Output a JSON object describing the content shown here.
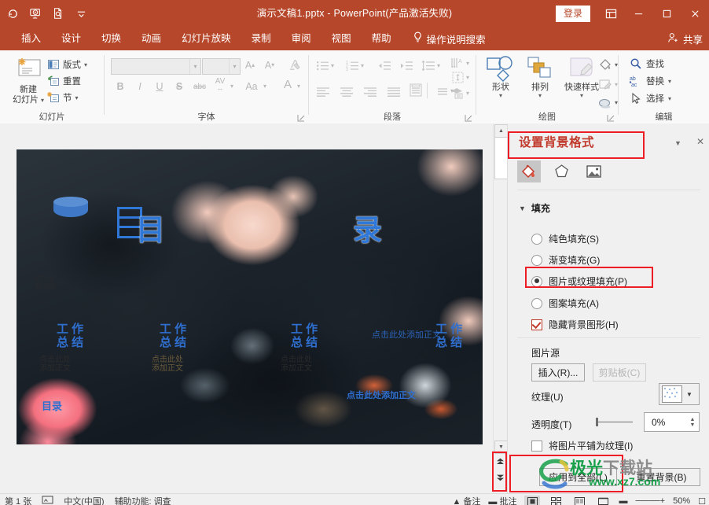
{
  "titlebar": {
    "document_title": "演示文稿1.pptx  -  PowerPoint(产品激活失败)",
    "signin_label": "登录",
    "quick_access": [
      {
        "name": "autosave-icon",
        "label": ""
      },
      {
        "name": "start-from-beginning-icon",
        "label": ""
      },
      {
        "name": "print-preview-icon",
        "label": ""
      },
      {
        "name": "customize-quick-access-toolbar-icon",
        "label": ""
      }
    ],
    "window_buttons": [
      "ribbon-display-options",
      "minimize",
      "maximize",
      "close"
    ]
  },
  "ribbon_tabs": {
    "items": [
      {
        "label": "插入"
      },
      {
        "label": "设计"
      },
      {
        "label": "切换"
      },
      {
        "label": "动画"
      },
      {
        "label": "幻灯片放映"
      },
      {
        "label": "录制"
      },
      {
        "label": "审阅"
      },
      {
        "label": "视图"
      },
      {
        "label": "帮助"
      }
    ],
    "tell_me": "操作说明搜索",
    "share": "共享"
  },
  "ribbon": {
    "groups": [
      {
        "name": "slide",
        "label": "幻灯片"
      },
      {
        "name": "font",
        "label": "字体"
      },
      {
        "name": "paragraph",
        "label": "段落"
      },
      {
        "name": "drawing",
        "label": "绘图"
      },
      {
        "name": "editing",
        "label": "编辑"
      }
    ],
    "slide_group": {
      "new_slide_line1": "新建",
      "new_slide_line2": "幻灯片",
      "layout": "版式",
      "reset": "重置",
      "section": "节"
    },
    "font_group": {
      "font_name_value": "",
      "font_size_value": "",
      "buttons": [
        "B",
        "I",
        "U",
        "S",
        "abc",
        "AV",
        "Aa",
        "A"
      ]
    },
    "drawing_group": {
      "shapes": "形状",
      "arrange": "排列",
      "quick_styles": "快速样式"
    },
    "editing_group": {
      "find": "查找",
      "replace": "替换",
      "select": "选择"
    }
  },
  "slide": {
    "texts": [
      {
        "id": "title-mu",
        "text": "目"
      },
      {
        "id": "title-lu",
        "text": "录"
      },
      {
        "id": "heading-1",
        "text": "工 作\n总 结"
      },
      {
        "id": "heading-2",
        "text": "工 作\n总 结"
      },
      {
        "id": "heading-3",
        "text": "工 作\n总 结"
      },
      {
        "id": "heading-4",
        "text": "工 作\n总 结"
      },
      {
        "id": "body-1",
        "text": "点击此处\n添加正文"
      },
      {
        "id": "body-2",
        "text": "点击此处\n添加正文"
      },
      {
        "id": "body-3",
        "text": "点击此处\n添加正文"
      },
      {
        "id": "body-4",
        "text": "点击此处添加正文"
      },
      {
        "id": "body-5",
        "text": "点击此处添加正文"
      },
      {
        "id": "small-left",
        "text": "点击此\n处添加"
      },
      {
        "id": "catalog",
        "text": "目录"
      }
    ]
  },
  "pane": {
    "title": "设置背景格式",
    "collapse_icon": "chevron-down-icon",
    "close_icon": "close-icon",
    "tabs": [
      {
        "name": "fill-tab",
        "selected": true
      },
      {
        "name": "effects-tab",
        "selected": false
      },
      {
        "name": "picture-tab",
        "selected": false
      }
    ],
    "fill_section_label": "填充",
    "fill_options": [
      {
        "label": "纯色填充(S)",
        "selected": false
      },
      {
        "label": "渐变填充(G)",
        "selected": false
      },
      {
        "label": "图片或纹理填充(P)",
        "selected": true
      },
      {
        "label": "图案填充(A)",
        "selected": false
      }
    ],
    "hide_background_graphics": {
      "label": "隐藏背景图形(H)",
      "checked": true
    },
    "picture_source_label": "图片源",
    "insert_button": "插入(R)...",
    "clipboard_button": "剪贴板(C)",
    "texture_label": "纹理(U)",
    "transparency_label": "透明度(T)",
    "transparency_value": "0%",
    "tile_label": "将图片平铺为纹理(I)",
    "apply_all_button": "应用到全部(L)",
    "reset_background_button": "重置背景(B)"
  },
  "scrollbar": {
    "prev_slide": "previous-slide-icon",
    "next_slide": "next-slide-icon"
  },
  "statusbar": {
    "slide_number": "第 1 张",
    "language": "中文(中国)",
    "accessibility": "辅助功能: 调查",
    "notes": "备注",
    "comments": "批注",
    "zoom_level": "50%"
  },
  "watermark": {
    "brand_green": "极光",
    "brand_grey": "下载站",
    "url": "www.xz7.com"
  },
  "highlights": {
    "color": "#ee1c24",
    "regions": [
      "pane-title",
      "picture-or-texture-fill-option",
      "apply-to-all-button",
      "slide-nav-buttons"
    ]
  }
}
